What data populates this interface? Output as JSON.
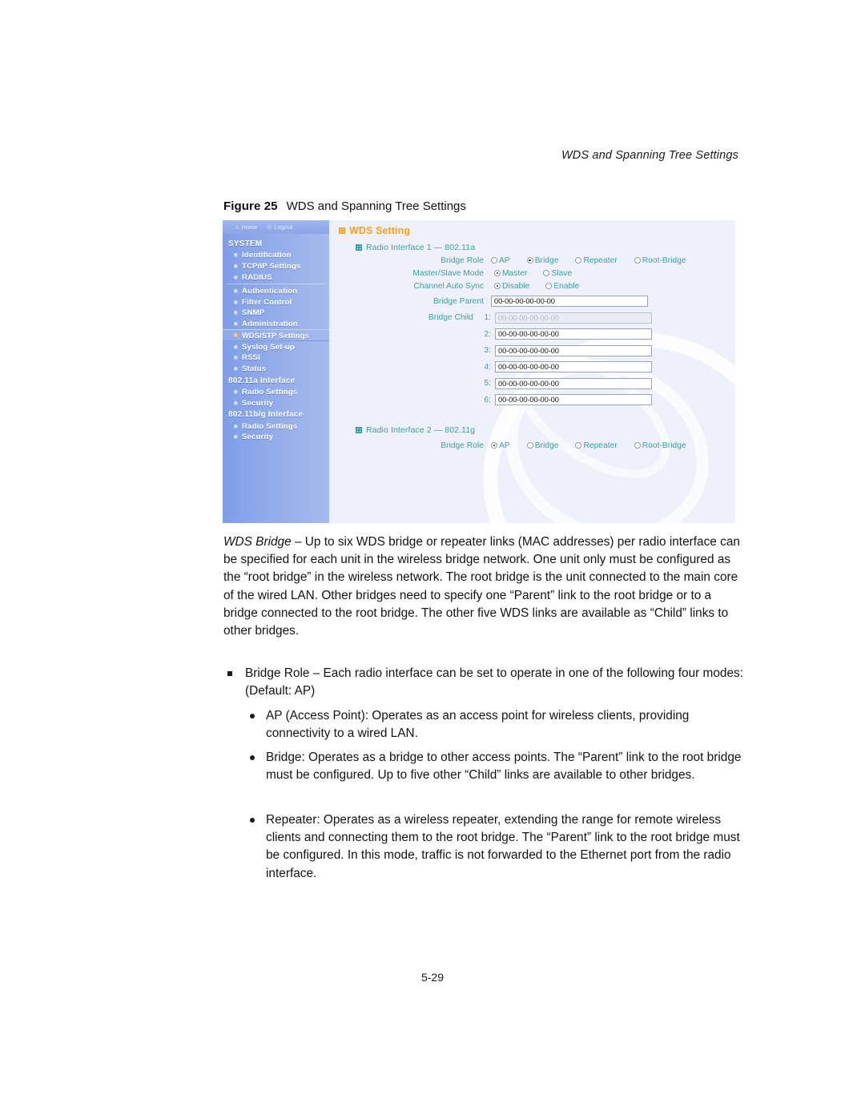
{
  "document": {
    "running_header": "WDS and Spanning Tree Settings",
    "page_number": "5-29"
  },
  "figure": {
    "label": "Figure 25",
    "title": "WDS and Spanning Tree Settings"
  },
  "screenshot": {
    "topbar": {
      "home_icon": "home-icon",
      "home_label": "Home",
      "logout_icon": "logout-person-icon",
      "logout_label": "Logout"
    },
    "sidebar": {
      "groups": [
        {
          "title": "SYSTEM",
          "items": [
            {
              "label": "Identification",
              "selected": false
            },
            {
              "label": "TCP/IP Settings",
              "selected": false
            },
            {
              "label": "RADIUS",
              "selected": false
            },
            {
              "label": "Authentication",
              "selected": false
            },
            {
              "label": "Filter Control",
              "selected": false
            },
            {
              "label": "SNMP",
              "selected": false
            },
            {
              "label": "Administration",
              "selected": false
            },
            {
              "label": "WDS/STP Settings",
              "selected": true
            },
            {
              "label": "Syslog Set-up",
              "selected": false
            },
            {
              "label": "RSSI",
              "selected": false
            },
            {
              "label": "Status",
              "selected": false
            }
          ]
        },
        {
          "title": "802.11a Interface",
          "items": [
            {
              "label": "Radio Settings",
              "selected": false
            },
            {
              "label": "Security",
              "selected": false
            }
          ]
        },
        {
          "title": "802.11b/g Interface",
          "items": [
            {
              "label": "Radio Settings",
              "selected": false
            },
            {
              "label": "Security",
              "selected": false
            }
          ]
        }
      ]
    },
    "panel": {
      "title": "WDS Setting",
      "radio1": {
        "heading": "Radio Interface 1 — 802.11a",
        "bridge_role_label": "Bridge Role",
        "bridge_role_options": [
          "AP",
          "Bridge",
          "Repeater",
          "Root-Bridge"
        ],
        "bridge_role_selected": "Bridge",
        "master_slave_label": "Master/Slave Mode",
        "master_slave_options": [
          "Master",
          "Slave"
        ],
        "master_slave_selected": "Master",
        "channel_sync_label": "Channel Auto Sync",
        "channel_sync_options": [
          "Disable",
          "Enable"
        ],
        "channel_sync_selected": "Disable",
        "bridge_parent_label": "Bridge Parent",
        "bridge_parent_value": "00-00-00-00-00-00",
        "bridge_child_label": "Bridge Child",
        "bridge_children": [
          {
            "index": "1:",
            "value": "00-00-00-00-00-00",
            "disabled": true
          },
          {
            "index": "2:",
            "value": "00-00-00-00-00-00",
            "disabled": false
          },
          {
            "index": "3:",
            "value": "00-00-00-00-00-00",
            "disabled": false
          },
          {
            "index": "4:",
            "value": "00-00-00-00-00-00",
            "disabled": false
          },
          {
            "index": "5:",
            "value": "00-00-00-00-00-00",
            "disabled": false
          },
          {
            "index": "6:",
            "value": "00-00-00-00-00-00",
            "disabled": false
          }
        ]
      },
      "radio2": {
        "heading": "Radio Interface 2 — 802.11g",
        "bridge_role_label": "Bridge Role",
        "bridge_role_options": [
          "AP",
          "Bridge",
          "Repeater",
          "Root-Bridge"
        ],
        "bridge_role_selected": "AP"
      }
    },
    "colors": {
      "sidebar_blue": "#8ca6e6",
      "panel_bg": "#eef1fb",
      "title_orange": "#F5A21E",
      "label_teal": "#3aa0a0",
      "selected_bullet": "#f0a72a"
    }
  },
  "content": {
    "wds_bridge_term": "WDS Bridge",
    "wds_bridge_body": " – Up to six WDS bridge or repeater links (MAC addresses) per radio interface can be specified for each unit in the wireless bridge network. One unit only must be configured as the “root bridge” in the wireless network. The root bridge is the unit connected to the main core of the wired LAN. Other bridges need to specify one “Parent” link to the root bridge or to a bridge connected to the root bridge. The other five WDS links are available as “Child” links to other bridges.",
    "bridge_role_term": "Bridge Role",
    "bridge_role_body": " – Each radio interface can be set to operate in one of the following four modes: (Default: AP)",
    "modes": [
      "AP (Access Point): Operates as an access point for wireless clients, providing connectivity to a wired LAN.",
      "Bridge: Operates as a bridge to other access points. The “Parent” link to the root bridge must be configured. Up to five other “Child” links are available to other bridges.",
      "Repeater: Operates as a wireless repeater, extending the range for remote wireless clients and connecting them to the root bridge. The “Parent” link to the root bridge must be configured. In this mode, traffic is not forwarded to the Ethernet port from the radio interface."
    ]
  }
}
